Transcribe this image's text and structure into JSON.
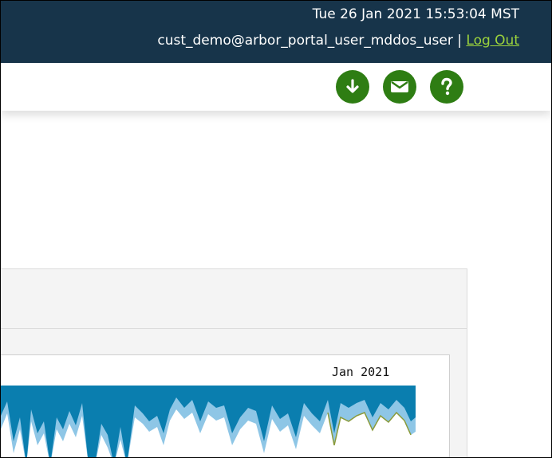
{
  "header": {
    "datetime": "Tue 26 Jan 2021 15:53:04 MST",
    "user": "cust_demo@arbor_portal_user_mddos_user",
    "separator": "|",
    "logout_label": "Log Out"
  },
  "toolbar": {
    "buttons": [
      {
        "icon": "download-icon"
      },
      {
        "icon": "mail-icon"
      },
      {
        "icon": "help-icon"
      }
    ]
  },
  "chart": {
    "period_label": "Jan 2021"
  },
  "colors": {
    "header_bg": "#17344a",
    "accent_green": "#2e7d13",
    "logout_link": "#9bd23c",
    "chart_dark_blue": "#0a7eaf",
    "chart_light_blue": "#8ec6e6",
    "chart_olive": "#8a9a3a"
  }
}
